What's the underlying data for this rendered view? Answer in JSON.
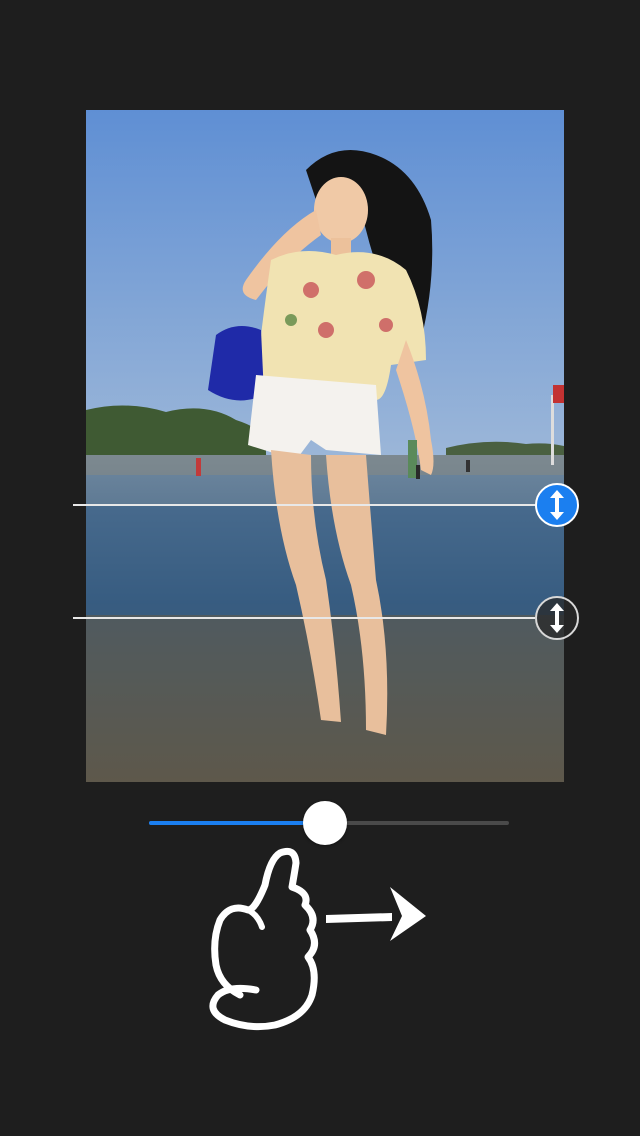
{
  "photo": {
    "sky_color": "#6f9ad6",
    "water_color": "#3f5e78",
    "sand_color": "#6c6454"
  },
  "guides": {
    "top_handle": {
      "icon": "vertical-resize-arrows-icon",
      "color": "#1b7ff0",
      "state": "active"
    },
    "bottom_handle": {
      "icon": "vertical-resize-arrows-icon",
      "color": "#2a2a2a",
      "state": "inactive"
    }
  },
  "slider": {
    "value": 0.49,
    "fill_color": "#1b7ff0",
    "track_color": "#4a4a4a"
  },
  "hint": {
    "icon": "swipe-right-hand-icon",
    "arrow_icon": "arrow-right-icon"
  }
}
